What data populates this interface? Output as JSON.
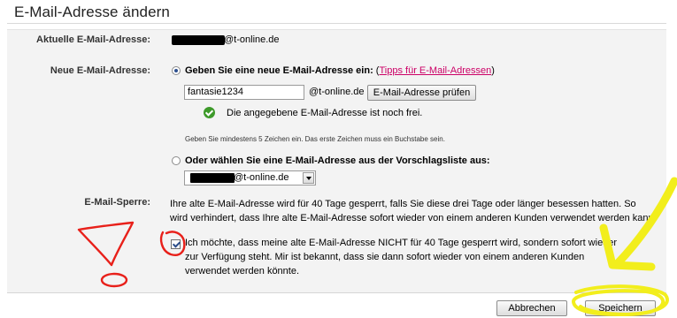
{
  "page_title": "E-Mail-Adresse ändern",
  "current_email": {
    "label": "Aktuelle E-Mail-Adresse:",
    "domain_suffix": "@t-online.de"
  },
  "new_email": {
    "label": "Neue E-Mail-Adresse:",
    "option_enter": {
      "label": "Geben Sie eine neue E-Mail-Adresse ein:",
      "link_open": "(",
      "link_text": "Tipps für E-Mail-Adressen",
      "link_close": ")",
      "selected": true
    },
    "input_value": "fantasie1234",
    "domain": "@t-online.de",
    "check_button": "E-Mail-Adresse prüfen",
    "availability_message": "Die angegebene E-Mail-Adresse ist noch frei.",
    "hint": "Geben Sie mindestens 5 Zeichen ein. Das erste Zeichen muss ein Buchstabe sein.",
    "option_suggest": {
      "label": "Oder wählen Sie eine E-Mail-Adresse aus der Vorschlagsliste aus:",
      "selected": false
    },
    "suggestion_domain": "@t-online.de"
  },
  "lock": {
    "label": "E-Mail-Sperre:",
    "description_line1": "Ihre alte E-Mail-Adresse wird für 40 Tage gesperrt, falls Sie diese drei Tage oder länger besessen hatten. So",
    "description_line2": "wird verhindert, dass Ihre alte E-Mail-Adresse sofort wieder von einem anderen Kunden verwendet werden kann.",
    "opt_out_line1": "Ich möchte, dass meine alte E-Mail-Adresse NICHT für 40 Tage gesperrt wird, sondern sofort wieder",
    "opt_out_line2": "zur Verfügung steht. Mir ist bekannt, dass sie dann sofort wieder von einem anderen Kunden",
    "opt_out_line3": "verwendet werden könnte.",
    "opt_out_checked": true
  },
  "buttons": {
    "cancel": "Abbrechen",
    "save": "Speichern"
  },
  "colors": {
    "link": "#cc0066",
    "success": "#3d9a2a",
    "annotation_red": "#e8201a",
    "annotation_yellow": "#f2ee1c"
  }
}
